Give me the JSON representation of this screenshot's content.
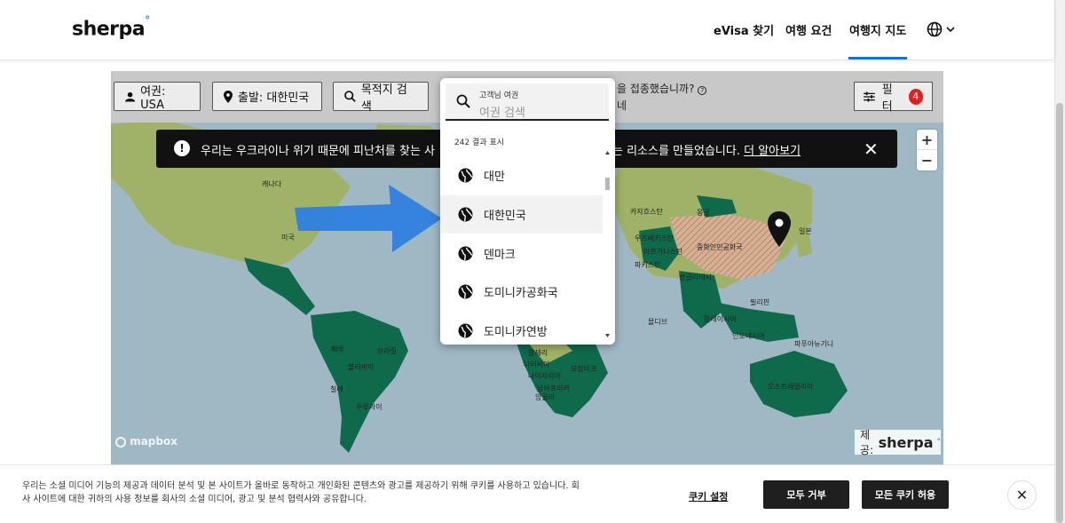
{
  "header": {
    "logo": "sherpa",
    "nav": [
      "eVisa 찾기",
      "여행 요건",
      "여행지 지도"
    ],
    "active_nav": "여행지 지도",
    "language_icon": "globe-icon"
  },
  "filters": {
    "passport": "여권: USA",
    "departure": "출발: 대한민국",
    "destination": "목적지 검색",
    "vaccinated_question": "을 접종했습니까?",
    "vaccinated_answer": "네",
    "filter_label": "필터",
    "filter_count": "4"
  },
  "banner": {
    "text": "우리는 우크라이나 위기 때문에 피난처를 찾는 사",
    "text_after": "는 리소스를 만들었습니다.",
    "link": "더 알아보기"
  },
  "map": {
    "labels": [
      "캐나다",
      "미국",
      "브라질",
      "볼리비아",
      "칠레",
      "우루과이",
      "카자흐스탄",
      "중화인민공화국",
      "방글라데시",
      "몽골",
      "파키스탄",
      "인도네시아",
      "말레이시아",
      "오스트레일리아",
      "알제리",
      "나이지리아",
      "모잠비크",
      "앙골라",
      "페루",
      "파푸아뉴기니",
      "몰디브",
      "우즈베키스탄",
      "아프가니스탄",
      "필리핀",
      "남아프리카",
      "나미비아",
      "일본"
    ],
    "attribution": "mapbox",
    "provider_label": "제공:",
    "provider_name": "sherpa"
  },
  "dropdown": {
    "search_label": "고객님 여권",
    "search_placeholder": "여권 검색",
    "result_count": "242 결과 표시",
    "items": [
      "대만",
      "대한민국",
      "덴마크",
      "도미니카공화국",
      "도미니카연방"
    ],
    "highlighted": "대한민국"
  },
  "cookie": {
    "text": "우리는 소셜 미디어 기능의 제공과 데이터 분석 및 본 사이트가 올바로 동작하고 개인화된 콘텐츠와 광고를 제공하기 위해 쿠키를 사용하고 있습니다. 회사 사이트에 대한 귀하의 사용 정보를 회사의 소셜 미디어, 광고 및 분석 협력사와 공유합니다.",
    "settings": "쿠키 설정",
    "reject": "모두 거부",
    "accept": "모든 쿠키 허용"
  },
  "colors": {
    "green_dark": "#0f6a4b",
    "green_light": "#9fb268",
    "ocean": "#9fb8c4",
    "china_hatch": "#c99a7a",
    "accent_blue": "#1b6fd1",
    "badge_red": "#e0201f"
  }
}
